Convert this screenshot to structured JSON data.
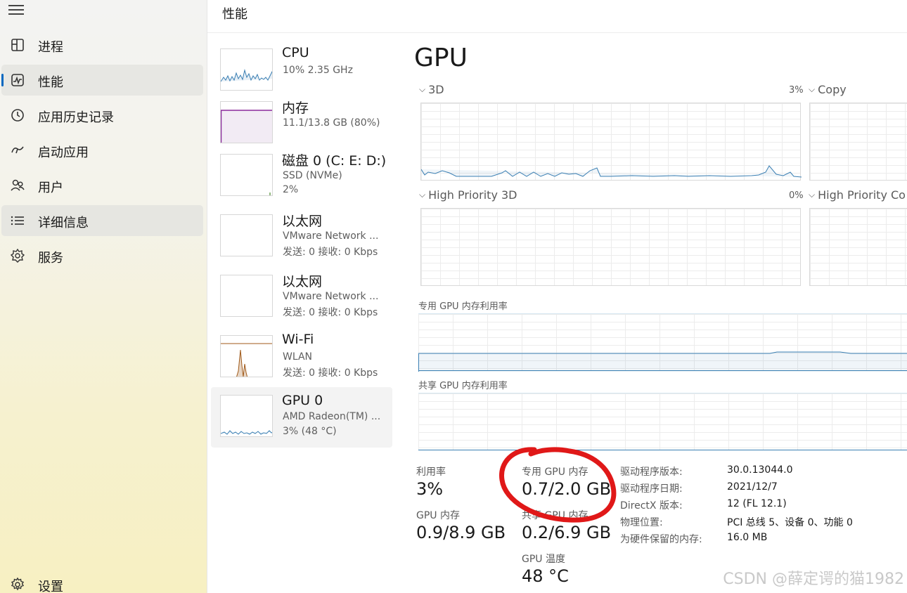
{
  "sidebar": {
    "menu_icon": "hamburger-icon",
    "items": [
      {
        "label": "进程",
        "icon": "processes-icon"
      },
      {
        "label": "性能",
        "icon": "performance-icon",
        "selected": true
      },
      {
        "label": "应用历史记录",
        "icon": "history-icon"
      },
      {
        "label": "启动应用",
        "icon": "startup-icon"
      },
      {
        "label": "用户",
        "icon": "users-icon"
      },
      {
        "label": "详细信息",
        "icon": "details-icon"
      },
      {
        "label": "服务",
        "icon": "services-icon"
      }
    ],
    "settings": {
      "label": "设置",
      "icon": "gear-icon"
    }
  },
  "header": {
    "title": "性能"
  },
  "resources": [
    {
      "name": "CPU",
      "lines": [
        "10% 2.35 GHz"
      ]
    },
    {
      "name": "内存",
      "lines": [
        "11.1/13.8 GB (80%)"
      ]
    },
    {
      "name": "磁盘 0 (C: E: D:)",
      "lines": [
        "SSD (NVMe)",
        "2%"
      ]
    },
    {
      "name": "以太网",
      "lines": [
        "VMware Network ...",
        "发送: 0 接收: 0 Kbps"
      ]
    },
    {
      "name": "以太网",
      "lines": [
        "VMware Network ...",
        "发送: 0 接收: 0 Kbps"
      ]
    },
    {
      "name": "Wi-Fi",
      "lines": [
        "WLAN",
        "发送: 0 接收: 0 Kbps"
      ]
    },
    {
      "name": "GPU 0",
      "lines": [
        "AMD Radeon(TM) ...",
        "3% (48 °C)"
      ],
      "selected": true
    }
  ],
  "main": {
    "title": "GPU",
    "engines": [
      {
        "label": "3D",
        "percent": "3%"
      },
      {
        "label": "Copy",
        "percent": ""
      },
      {
        "label": "High Priority 3D",
        "percent": "0%"
      },
      {
        "label": "High Priority Co",
        "percent": ""
      }
    ],
    "dedicated_mem_label": "专用 GPU 内存利用率",
    "shared_mem_label": "共享 GPU 内存利用率",
    "stats": {
      "utilization_label": "利用率",
      "utilization_value": "3%",
      "dedicated_label": "专用 GPU 内存",
      "dedicated_value": "0.7/2.0 GB",
      "gpu_mem_label": "GPU 内存",
      "gpu_mem_value": "0.9/8.9 GB",
      "shared_label": "共享 GPU 内存",
      "shared_value": "0.2/6.9 GB",
      "temp_label": "GPU 温度",
      "temp_value": "48 °C"
    },
    "properties": [
      {
        "key": "驱动程序版本:",
        "value": "30.0.13044.0"
      },
      {
        "key": "驱动程序日期:",
        "value": "2021/12/7"
      },
      {
        "key": "DirectX 版本:",
        "value": "12 (FL 12.1)"
      },
      {
        "key": "物理位置:",
        "value": "PCI 总线 5、设备 0、功能 0"
      },
      {
        "key": "为硬件保留的内存:",
        "value": "16.0 MB"
      }
    ]
  },
  "watermark": "CSDN @薛定谔的猫1982",
  "colors": {
    "accent": "#0067c0",
    "graph_line": "#3a7fb3",
    "memory_line": "#8b2a9b",
    "wifi_line": "#a05a1a",
    "annotation": "#e01818"
  }
}
